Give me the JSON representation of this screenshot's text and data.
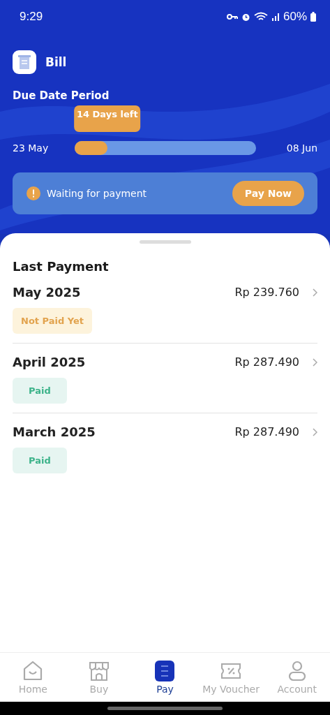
{
  "status_bar": {
    "time": "9:29",
    "battery": "60%"
  },
  "header": {
    "title": "Bill"
  },
  "due_period": {
    "title": "Due Date Period",
    "tooltip": "14 Days left",
    "start": "23 May",
    "end": "08 Jun",
    "level": 0.18
  },
  "alert": {
    "message": "Waiting for payment",
    "button": "Pay Now"
  },
  "last_payment": {
    "title": "Last Payment",
    "items": [
      {
        "month": "May 2025",
        "amount": "Rp 239.760",
        "status": "Not Paid Yet",
        "kind": "unpaid"
      },
      {
        "month": "April 2025",
        "amount": "Rp 287.490",
        "status": "Paid",
        "kind": "paid"
      },
      {
        "month": "March 2025",
        "amount": "Rp 287.490",
        "status": "Paid",
        "kind": "paid"
      }
    ]
  },
  "nav": [
    {
      "label": "Home",
      "kind": "home",
      "selected": false
    },
    {
      "label": "Buy",
      "kind": "store",
      "selected": false
    },
    {
      "label": "Pay",
      "kind": "bill",
      "selected": true
    },
    {
      "label": "My Voucher",
      "kind": "voucher",
      "selected": false
    },
    {
      "label": "Account",
      "kind": "user",
      "selected": false
    }
  ]
}
